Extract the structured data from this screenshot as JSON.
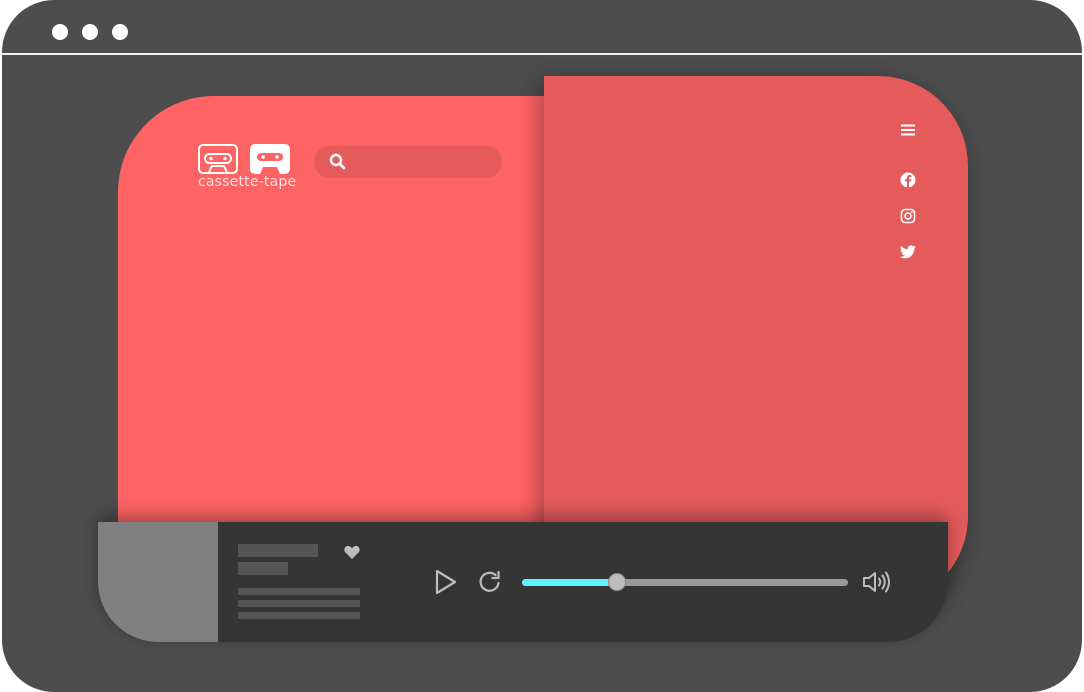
{
  "window": {
    "controls": [
      "window-dot-1",
      "window-dot-2",
      "window-dot-3"
    ]
  },
  "brand": {
    "name": "cassette-tape",
    "icons": [
      "cassette-outline-icon",
      "cassette-solid-icon"
    ]
  },
  "search": {
    "placeholder": "",
    "value": "",
    "icon": "search-icon"
  },
  "nav": {
    "menu_icon": "hamburger-menu-icon",
    "social": [
      {
        "name": "facebook",
        "icon": "facebook-icon"
      },
      {
        "name": "instagram",
        "icon": "instagram-icon"
      },
      {
        "name": "twitter",
        "icon": "twitter-icon"
      }
    ]
  },
  "player": {
    "track_title": "",
    "track_artist": "",
    "like_icon": "heart-icon",
    "controls": {
      "play_icon": "play-icon",
      "repeat_icon": "repeat-icon",
      "volume_icon": "volume-icon"
    },
    "progress": 0.29
  },
  "colors": {
    "window": "#4d4d4d",
    "panel_left": "#ff6464",
    "panel_right": "#e55b5b",
    "player_bar": "#353535",
    "album_art": "#808080",
    "progress_fill": "#5ff0ff",
    "progress_track": "#999999",
    "icon": "#ffffff"
  }
}
